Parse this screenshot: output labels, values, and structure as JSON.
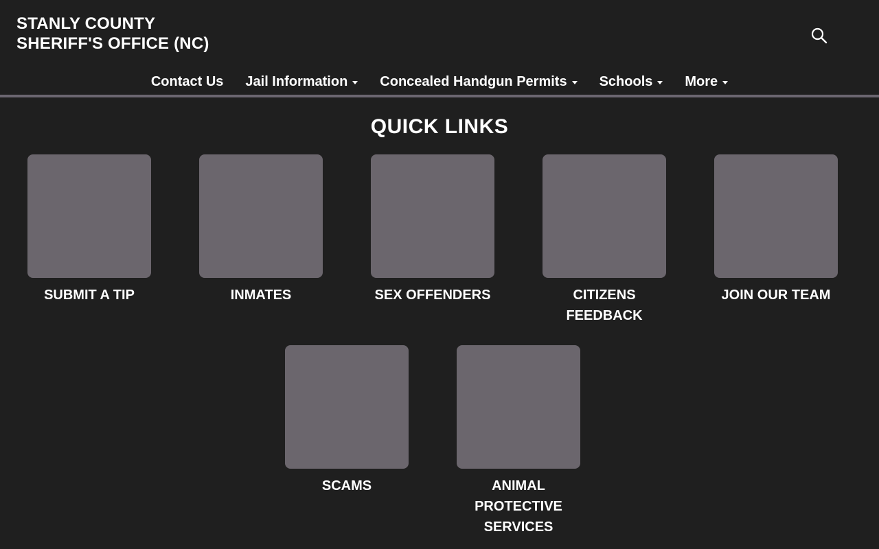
{
  "site": {
    "title_line1": "STANLY COUNTY",
    "title_line2": "SHERIFF'S OFFICE (NC)",
    "search_icon": "search-icon"
  },
  "nav": {
    "items": [
      {
        "label": "Contact Us",
        "has_dropdown": false
      },
      {
        "label": "Jail Information",
        "has_dropdown": true
      },
      {
        "label": "Concealed Handgun Permits",
        "has_dropdown": true
      },
      {
        "label": "Schools",
        "has_dropdown": true
      },
      {
        "label": "More",
        "has_dropdown": true
      }
    ]
  },
  "quick_links": {
    "title": "QUICK LINKS",
    "items": [
      {
        "label": "SUBMIT A TIP"
      },
      {
        "label": "INMATES"
      },
      {
        "label": "SEX OFFENDERS"
      },
      {
        "label": "CITIZENS FEEDBACK"
      },
      {
        "label": "JOIN OUR TEAM"
      },
      {
        "label": "SCAMS"
      },
      {
        "label": "ANIMAL PROTECTIVE SERVICES"
      }
    ]
  },
  "colors": {
    "background": "#1f1f1f",
    "tile": "#6b666d",
    "divider": "#6b6670",
    "text": "#ffffff"
  }
}
